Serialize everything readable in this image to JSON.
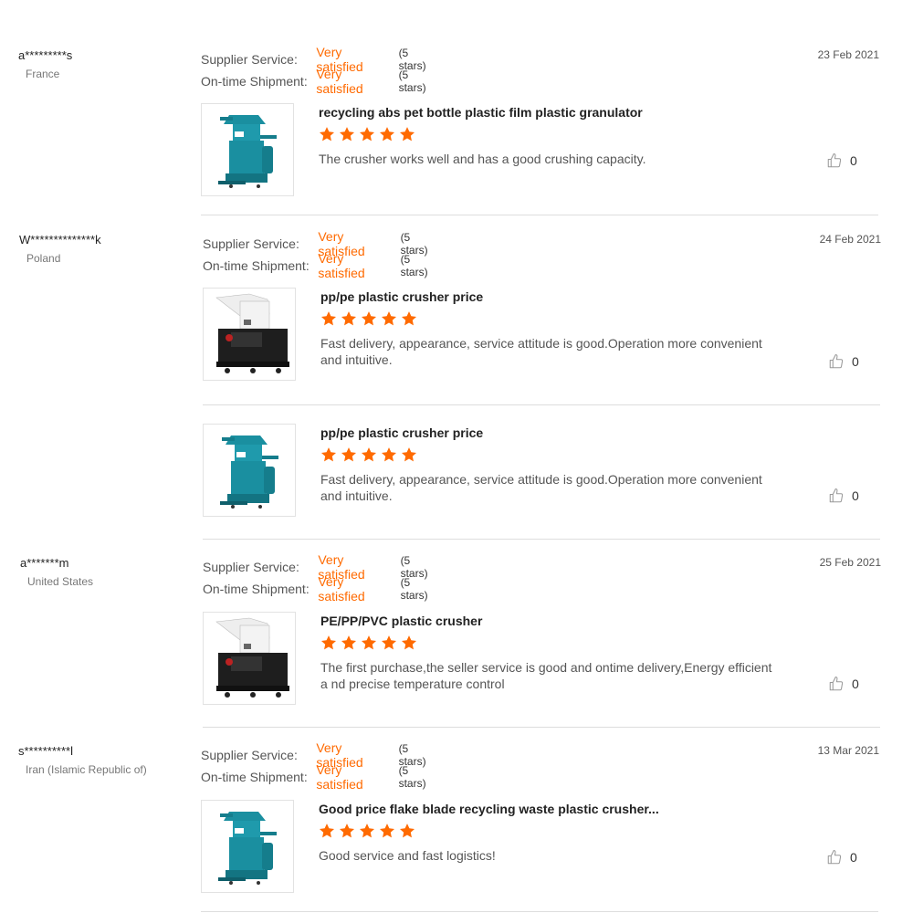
{
  "labels": {
    "supplier_service": "Supplier Service:",
    "on_time_shipment": "On-time Shipment:"
  },
  "colors": {
    "accent": "#ff6a00",
    "star": "#ff6a00",
    "machine_teal": "#1a8fa0"
  },
  "reviews": [
    {
      "user": "a*********s",
      "country": "France",
      "date": "23 Feb 2021",
      "supplier_service": "Very satisfied",
      "supplier_stars": "(5 stars)",
      "shipment": "Very satisfied",
      "shipment_stars": "(5 stars)",
      "items": [
        {
          "title": "recycling abs pet bottle plastic film plastic granulator",
          "rating": 5,
          "comment": "The crusher works well and has a good crushing capacity.",
          "likes": "0",
          "image": "teal-crusher-icon"
        }
      ]
    },
    {
      "user": "W**************k",
      "country": "Poland",
      "date": "24 Feb 2021",
      "supplier_service": "Very satisfied",
      "supplier_stars": "(5 stars)",
      "shipment": "Very satisfied",
      "shipment_stars": "(5 stars)",
      "items": [
        {
          "title": "pp/pe plastic crusher price",
          "rating": 5,
          "comment": "Fast delivery, appearance, service attitude is good.Operation more convenient and intuitive.",
          "likes": "0",
          "image": "white-black-crusher-icon"
        },
        {
          "title": "pp/pe plastic crusher price",
          "rating": 5,
          "comment": "Fast delivery, appearance, service attitude is good.Operation more convenient and intuitive.",
          "likes": "0",
          "image": "teal-crusher-icon"
        }
      ]
    },
    {
      "user": "a*******m",
      "country": "United States",
      "date": "25 Feb 2021",
      "supplier_service": "Very satisfied",
      "supplier_stars": "(5 stars)",
      "shipment": "Very satisfied",
      "shipment_stars": "(5 stars)",
      "items": [
        {
          "title": "PE/PP/PVC plastic crusher",
          "rating": 5,
          "comment": "The first purchase,the seller service is good and ontime delivery,Energy efficient a nd precise temperature control",
          "likes": "0",
          "image": "white-black-crusher-icon"
        }
      ]
    },
    {
      "user": "s**********l",
      "country": "Iran (Islamic Republic of)",
      "date": "13 Mar 2021",
      "supplier_service": "Very satisfied",
      "supplier_stars": "(5 stars)",
      "shipment": "Very satisfied",
      "shipment_stars": "(5 stars)",
      "items": [
        {
          "title": "Good price flake blade recycling waste plastic crusher...",
          "rating": 5,
          "comment": "Good service and fast logistics!",
          "likes": "0",
          "image": "teal-crusher-icon"
        }
      ]
    }
  ]
}
